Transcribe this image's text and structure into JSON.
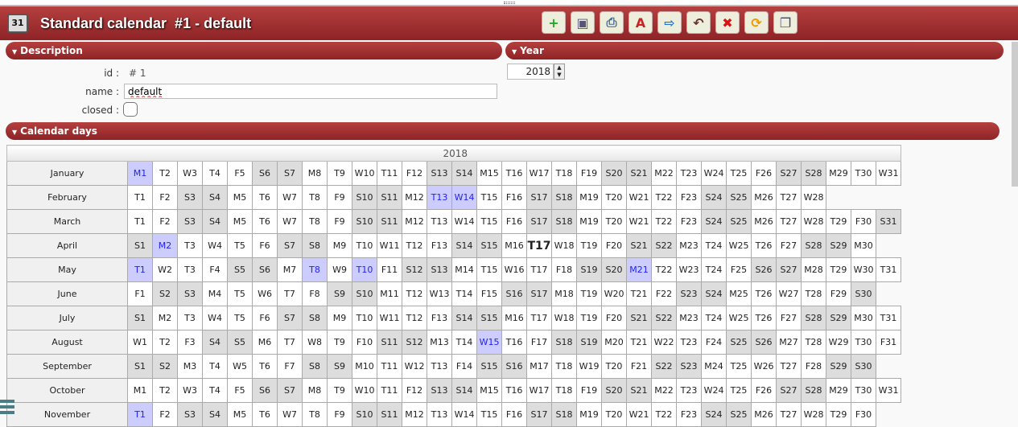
{
  "header": {
    "title": "Standard calendar  #1 - default",
    "icon_text": "31",
    "toolbar": [
      {
        "name": "new-button",
        "glyph": "+",
        "color": "#2a2"
      },
      {
        "name": "save-button",
        "glyph": "▣",
        "color": "#557"
      },
      {
        "name": "print-button",
        "glyph": "⎙",
        "color": "#468"
      },
      {
        "name": "pdf-button",
        "glyph": "A",
        "color": "#c22"
      },
      {
        "name": "copy-button",
        "glyph": "⇨",
        "color": "#27c"
      },
      {
        "name": "undo-button",
        "glyph": "↶",
        "color": "#633"
      },
      {
        "name": "delete-button",
        "glyph": "✖",
        "color": "#d11"
      },
      {
        "name": "refresh-button",
        "glyph": "⟳",
        "color": "#e90"
      },
      {
        "name": "multi-window-button",
        "glyph": "❐",
        "color": "#446"
      }
    ]
  },
  "description": {
    "section_label": "Description",
    "id_label": "id :",
    "id_value": "# 1",
    "name_label": "name :",
    "name_value": "default",
    "closed_label": "closed :"
  },
  "year": {
    "section_label": "Year",
    "value": "2018"
  },
  "calendar": {
    "section_label": "Calendar days",
    "year_header": "2018",
    "colors": {
      "weekend": "#dddddd",
      "holiday": "#ccccff"
    },
    "months": [
      {
        "name": "January",
        "days": "M1 T2 W3 T4 F5 S6 S7 M8 T9 W10 T11 F12 S13 S14 M15 T16 W17 T18 F19 S20 S21 M22 T23 W24 T25 F26 S27 S28 M29 T30 W31",
        "holidays": [
          1
        ]
      },
      {
        "name": "February",
        "days": "T1 F2 S3 S4 M5 T6 W7 T8 F9 S10 S11 M12 T13 W14 T15 F16 S17 S18 M19 T20 W21 T22 F23 S24 S25 M26 T27 W28",
        "holidays": [
          13,
          14
        ]
      },
      {
        "name": "March",
        "days": "T1 F2 S3 S4 M5 T6 W7 T8 F9 S10 S11 M12 T13 W14 T15 F16 S17 S18 M19 T20 W21 T22 F23 S24 S25 M26 T27 W28 T29 F30 S31",
        "holidays": []
      },
      {
        "name": "April",
        "days": "S1 M2 T3 W4 T5 F6 S7 S8 M9 T10 W11 T12 F13 S14 S15 M16 T17 W18 T19 F20 S21 S22 M23 T24 W25 T26 F27 S28 S29 M30",
        "holidays": [
          2
        ],
        "today": 17
      },
      {
        "name": "May",
        "days": "T1 W2 T3 F4 S5 S6 M7 T8 W9 T10 F11 S12 S13 M14 T15 W16 T17 F18 S19 S20 M21 T22 W23 T24 F25 S26 S27 M28 T29 W30 T31",
        "holidays": [
          1,
          8,
          10,
          21
        ]
      },
      {
        "name": "June",
        "days": "F1 S2 S3 M4 T5 W6 T7 F8 S9 S10 M11 T12 W13 T14 F15 S16 S17 M18 T19 W20 T21 F22 S23 S24 M25 T26 W27 T28 F29 S30",
        "holidays": []
      },
      {
        "name": "July",
        "days": "S1 M2 T3 W4 T5 F6 S7 S8 M9 T10 W11 T12 F13 S14 S15 M16 T17 W18 T19 F20 S21 S22 M23 T24 W25 T26 F27 S28 S29 M30 T31",
        "holidays": []
      },
      {
        "name": "August",
        "days": "W1 T2 F3 S4 S5 M6 T7 W8 T9 F10 S11 S12 M13 T14 W15 T16 F17 S18 S19 M20 T21 W22 T23 F24 S25 S26 M27 T28 W29 T30 F31",
        "holidays": [
          15
        ]
      },
      {
        "name": "September",
        "days": "S1 S2 M3 T4 W5 T6 F7 S8 S9 M10 T11 W12 T13 F14 S15 S16 M17 T18 W19 T20 F21 S22 S23 M24 T25 W26 T27 F28 S29 S30",
        "holidays": []
      },
      {
        "name": "October",
        "days": "M1 T2 W3 T4 F5 S6 S7 M8 T9 W10 T11 F12 S13 S14 M15 T16 W17 T18 F19 S20 S21 M22 T23 W24 T25 F26 S27 S28 M29 T30 W31",
        "holidays": []
      },
      {
        "name": "November",
        "days": "T1 F2 S3 S4 M5 T6 W7 T8 F9 S10 S11 M12 T13 W14 T15 F16 S17 S18 M19 T20 W21 T22 F23 S24 S25 M26 T27 W28 T29 F30",
        "holidays": [
          1
        ]
      }
    ]
  }
}
